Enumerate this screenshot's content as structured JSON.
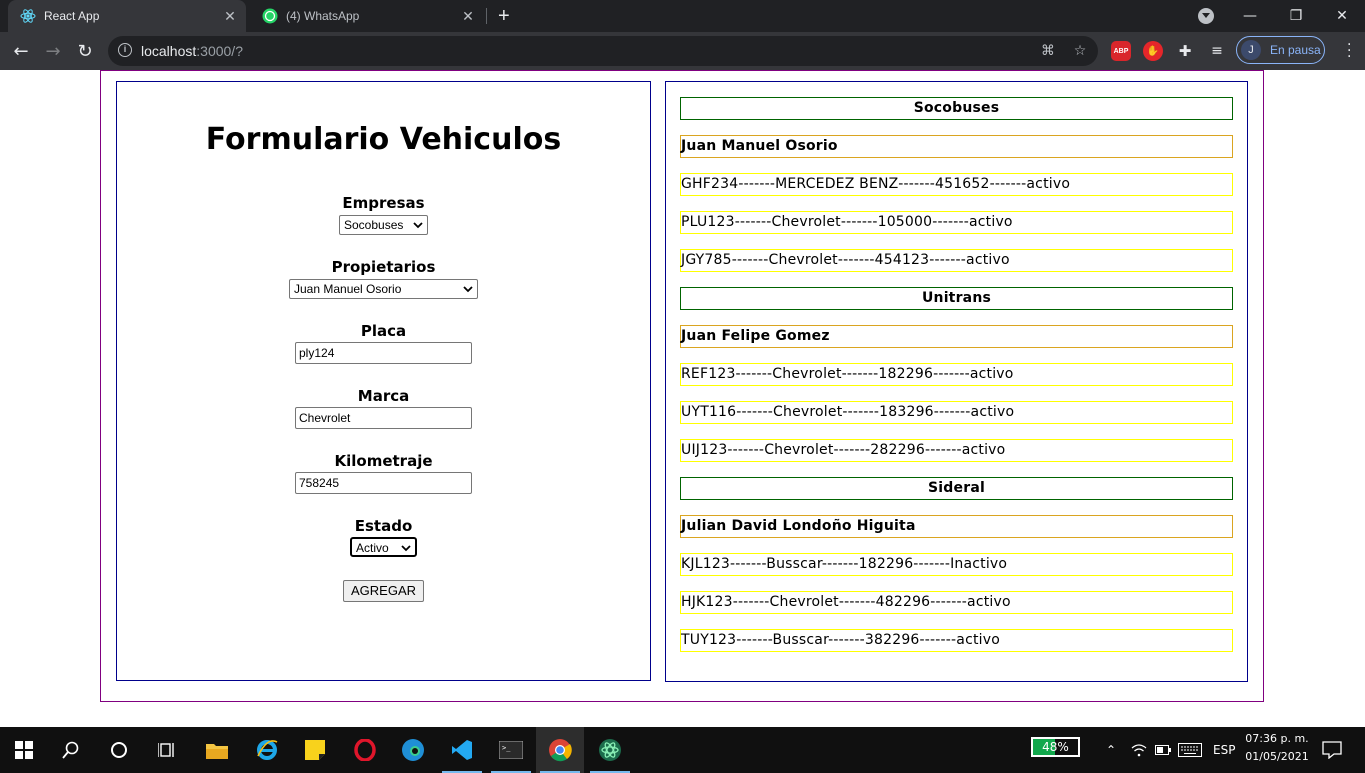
{
  "browser": {
    "tabs": [
      {
        "title": "React App",
        "active": true
      },
      {
        "title": "(4) WhatsApp",
        "active": false
      }
    ],
    "url_host": "localhost",
    "url_rest": ":3000/?",
    "profile_initial": "J",
    "profile_status": "En pausa",
    "abp_label": "ABP"
  },
  "form": {
    "title": "Formulario Vehiculos",
    "empresas_label": "Empresas",
    "empresas_value": "Socobuses",
    "propietarios_label": "Propietarios",
    "propietarios_value": "Juan Manuel Osorio",
    "placa_label": "Placa",
    "placa_value": "ply124",
    "marca_label": "Marca",
    "marca_value": "Chevrolet",
    "kilometraje_label": "Kilometraje",
    "kilometraje_value": "758245",
    "estado_label": "Estado",
    "estado_value": "Activo",
    "submit_label": "AGREGAR"
  },
  "list": {
    "groups": [
      {
        "company": "Socobuses",
        "owner": "Juan Manuel Osorio",
        "vehicles": [
          "GHF234-------MERCEDEZ BENZ-------451652-------activo",
          "PLU123-------Chevrolet-------105000-------activo",
          "JGY785-------Chevrolet-------454123-------activo"
        ]
      },
      {
        "company": "Unitrans",
        "owner": "Juan Felipe Gomez",
        "vehicles": [
          "REF123-------Chevrolet-------182296-------activo",
          "UYT116-------Chevrolet-------183296-------activo",
          "UIJ123-------Chevrolet-------282296-------activo"
        ]
      },
      {
        "company": "Sideral",
        "owner": "Julian David Londoño Higuita",
        "vehicles": [
          "KJL123-------Busscar-------182296-------Inactivo",
          "HJK123-------Chevrolet-------482296-------activo",
          "TUY123-------Busscar-------382296-------activo"
        ]
      }
    ]
  },
  "taskbar": {
    "battery_percent": "48%",
    "battery_level": 0.48,
    "language": "ESP",
    "time": "07:36 p. m.",
    "date": "01/05/2021"
  },
  "colors": {
    "company_border": "#006400",
    "owner_border": "#daa520",
    "vehicle_border": "#ffff00",
    "panel_border": "#00008b",
    "outer_border": "#800080"
  }
}
